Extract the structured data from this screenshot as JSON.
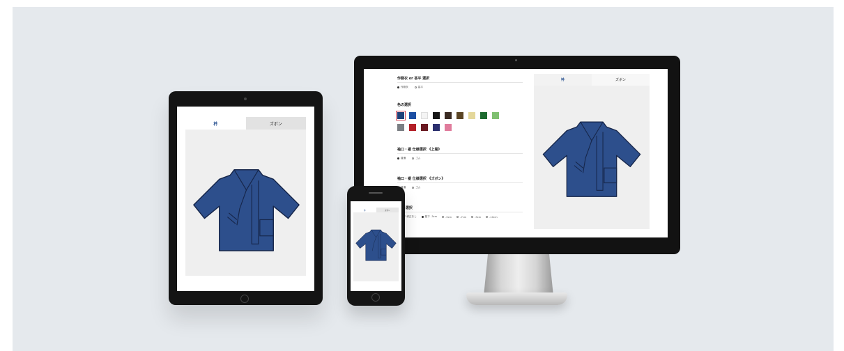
{
  "tablet": {
    "tabs": [
      {
        "label": "衿",
        "active": true
      },
      {
        "label": "ズボン",
        "active": false
      }
    ]
  },
  "monitor": {
    "sections": [
      {
        "title": "作務衣 or 甚平 選択",
        "options": [
          "作務衣",
          "甚平"
        ],
        "selected": 0
      },
      {
        "title": "色の選択"
      },
      {
        "title": "袖口・裾 仕様選択 《上着》",
        "options": [
          "普通",
          "ゴム"
        ],
        "selected": 0
      },
      {
        "title": "袖口・裾 仕様選択 《ズボン》",
        "options": [
          "普通",
          "ゴム"
        ],
        "selected": 0
      },
      {
        "title": "股下 選択",
        "options": [
          "股下 修正なし",
          "股下 -3cm",
          "-5cm",
          "-7cm",
          "-9cm",
          "-10cm"
        ],
        "selected": 1
      }
    ],
    "colors": [
      [
        "#1f4178",
        "#1c4fa3",
        "#f4f4f4",
        "#161616",
        "#3a2a22",
        "#5a4424",
        "#e4d79a",
        "#1d6a2f",
        "#7fc070"
      ],
      [
        "#7b7f84",
        "#b32028",
        "#6a1a22",
        "#2b2f6e",
        "#e07c9c"
      ]
    ],
    "selected_color_index": 0,
    "tabs": [
      {
        "label": "衿",
        "active": true
      },
      {
        "label": "ズボン",
        "active": false
      }
    ]
  },
  "phone": {
    "tabs": [
      {
        "label": "衿",
        "active": true
      },
      {
        "label": "ズボン",
        "active": false
      }
    ]
  },
  "product": {
    "garment_color": "#2d4f8c",
    "garment_outline": "#16264a",
    "background": "#e5e9ed"
  }
}
